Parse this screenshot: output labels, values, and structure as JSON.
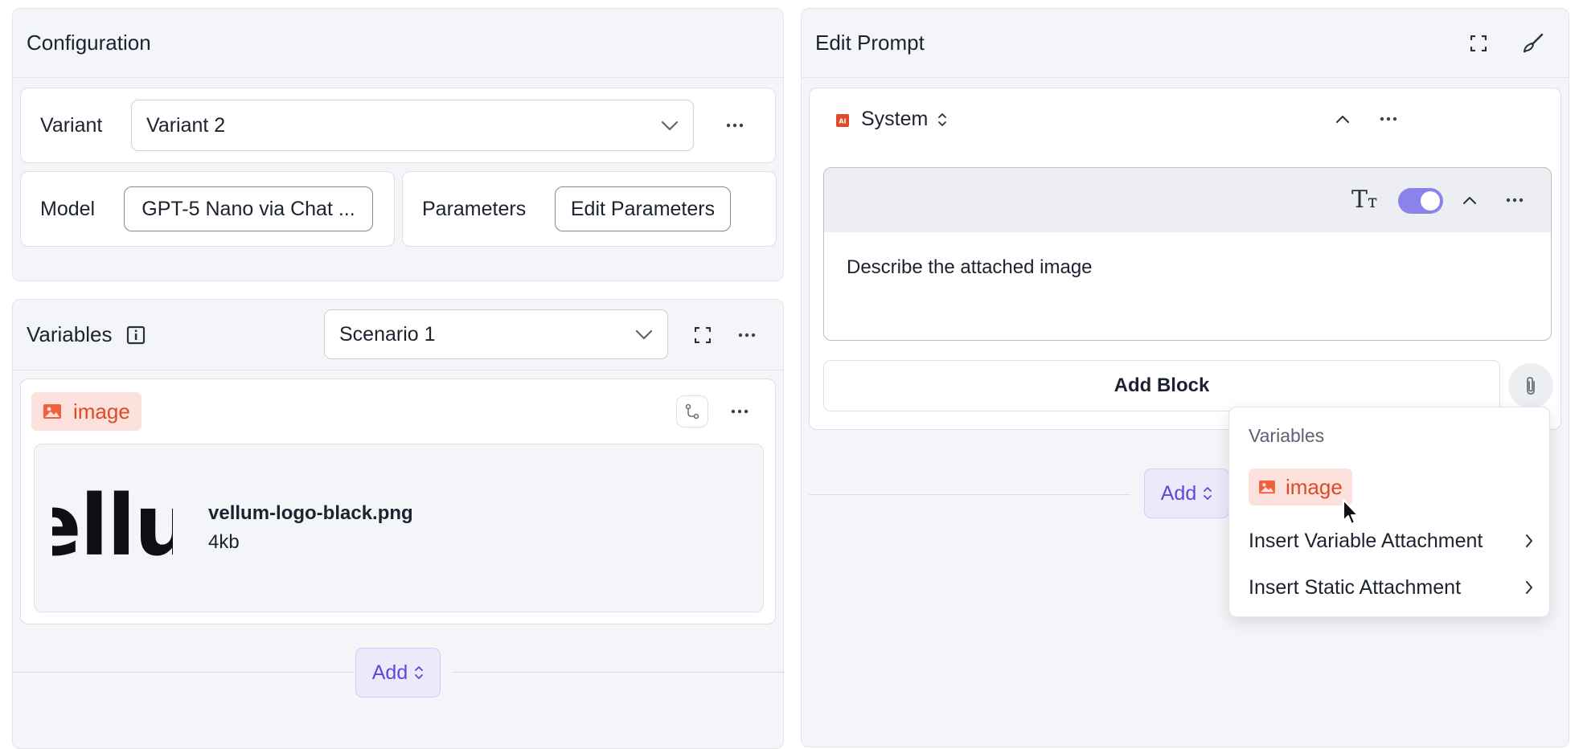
{
  "configuration": {
    "title": "Configuration",
    "variant_label": "Variant",
    "variant_value": "Variant 2",
    "model_label": "Model",
    "model_value": "GPT-5 Nano via Chat ...",
    "parameters_label": "Parameters",
    "edit_parameters_label": "Edit Parameters"
  },
  "variables": {
    "title": "Variables",
    "scenario_value": "Scenario 1",
    "variable_name": "image",
    "file_name": "vellum-logo-black.png",
    "file_size": "4kb",
    "logo_text": "ellu",
    "add_label": "Add"
  },
  "edit_prompt": {
    "title": "Edit Prompt",
    "block_role": "System",
    "message_text": "Describe the attached image",
    "add_block_label": "Add Block",
    "add_label": "Add",
    "toggle_on": true
  },
  "dropdown_menu": {
    "section_label": "Variables",
    "variable_item": "image",
    "insert_variable_attachment": "Insert Variable Attachment",
    "insert_static_attachment": "Insert Static Attachment"
  },
  "colors": {
    "accent": "#5a49d6",
    "toggle": "#8c82eb",
    "variable_chip_bg": "#fde1dc",
    "variable_chip_text": "#de4a26"
  }
}
